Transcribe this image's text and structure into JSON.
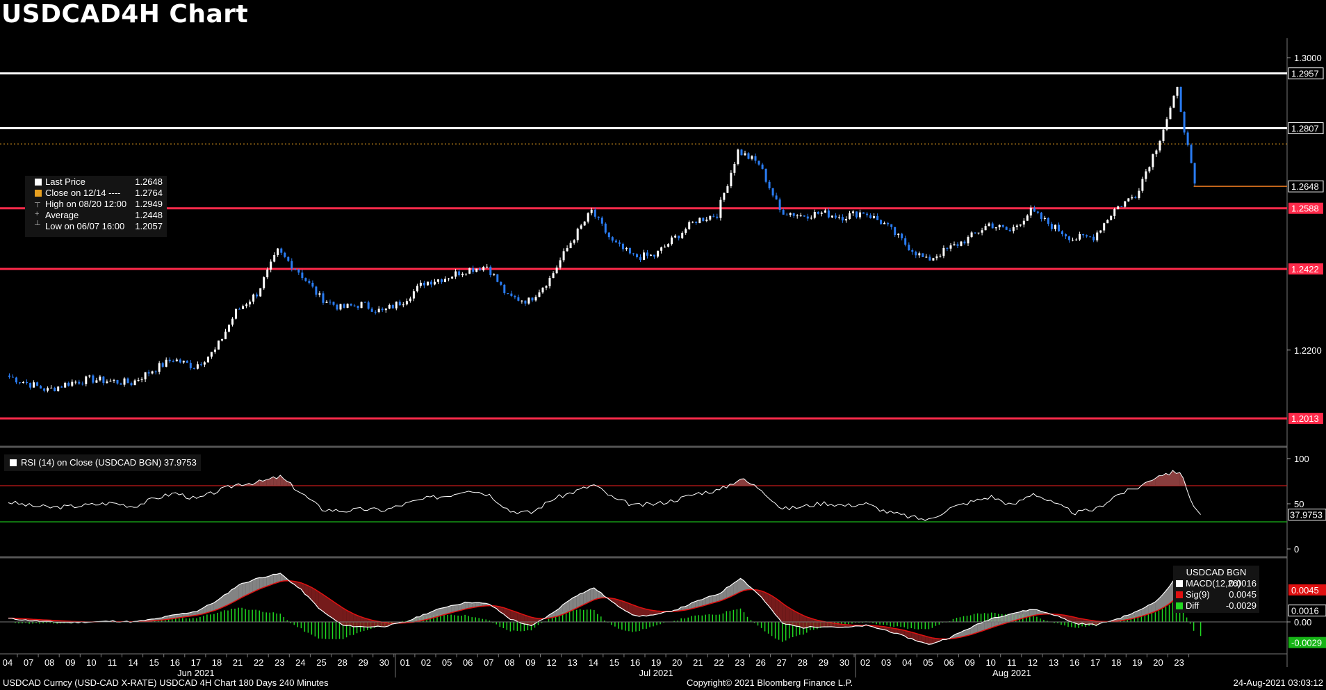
{
  "title": "USDCAD4H Chart",
  "footer": {
    "left": "USDCAD Curncy (USD-CAD X-RATE) USDCAD 4H Chart 180 Days 240 Minutes",
    "center": "Copyright© 2021 Bloomberg Finance L.P.",
    "right": "24-Aug-2021 03:03:12"
  },
  "legend": {
    "last_label": "Last Price",
    "last_value": "1.2648",
    "close_label": "Close on 12/14 ----",
    "close_value": "1.2764",
    "high_label": "High on 08/20 12:00",
    "high_value": "1.2949",
    "avg_label": "Average",
    "avg_value": "1.2448",
    "low_label": "Low on 06/07 16:00",
    "low_value": "1.2057"
  },
  "rsi_legend": "RSI (14)  on Close (USDCAD BGN) 37.9753",
  "macd_legend": {
    "title": "USDCAD BGN",
    "macd_label": "MACD(12,26)",
    "macd_value": "0.0016",
    "sig_label": "Sig(9)",
    "sig_value": "0.0045",
    "diff_label": "Diff",
    "diff_value": "-0.0029"
  },
  "colors": {
    "background": "#000000",
    "up_candle": "#ffffff",
    "down_candle": "#2a7cf2",
    "support_line": "#ff2a4a",
    "resistance_line": "#ffffff",
    "close_line": "#e8a020",
    "last_price_line": "#e87a20",
    "rsi_line": "#ffffff",
    "rsi_overbought": "#c41a1a",
    "rsi_oversold": "#1ab81a",
    "macd_line": "#ffffff",
    "signal_line": "#e01010",
    "diff_hist": "#21d821"
  },
  "chart_data": [
    {
      "type": "candlestick",
      "title": "USDCAD4H Chart",
      "price_axis": {
        "ticks": [
          "1.3000",
          "1.2200"
        ],
        "range": [
          1.196,
          1.304
        ]
      },
      "horizontal_levels": [
        {
          "label": "1.2957",
          "value": 1.2957,
          "color": "#ffffff"
        },
        {
          "label": "1.2807",
          "value": 1.2807,
          "color": "#ffffff"
        },
        {
          "label": "1.2588",
          "value": 1.2588,
          "color": "#ff2a4a"
        },
        {
          "label": "1.2422",
          "value": 1.2422,
          "color": "#ff2a4a"
        },
        {
          "label": "1.2013",
          "value": 1.2013,
          "color": "#ff2a4a"
        }
      ],
      "close_reference": 1.2764,
      "last_price": {
        "label": "1.2648",
        "value": 1.2648
      },
      "x_dates": [
        "04",
        "07",
        "08",
        "09",
        "10",
        "11",
        "14",
        "15",
        "16",
        "17",
        "18",
        "21",
        "22",
        "23",
        "24",
        "25",
        "28",
        "29",
        "30",
        "01",
        "02",
        "05",
        "06",
        "07",
        "08",
        "09",
        "12",
        "13",
        "14",
        "15",
        "16",
        "19",
        "20",
        "21",
        "22",
        "23",
        "26",
        "27",
        "28",
        "29",
        "30",
        "02",
        "03",
        "04",
        "05",
        "06",
        "09",
        "10",
        "11",
        "12",
        "13",
        "16",
        "17",
        "18",
        "19",
        "20",
        "23"
      ],
      "month_labels": [
        {
          "label": "Jun 2021",
          "at_index": 9
        },
        {
          "label": "Jul 2021",
          "at_index": 31
        },
        {
          "label": "Aug 2021",
          "at_index": 48
        }
      ],
      "daily_close": [
        1.213,
        1.211,
        1.209,
        1.211,
        1.212,
        1.2115,
        1.211,
        1.2145,
        1.2175,
        1.2155,
        1.2198,
        1.2305,
        1.2355,
        1.247,
        1.2415,
        1.2345,
        1.2315,
        1.2325,
        1.2305,
        1.2335,
        1.2385,
        1.2398,
        1.242,
        1.243,
        1.2345,
        1.2335,
        1.2395,
        1.2495,
        1.258,
        1.2495,
        1.2455,
        1.2458,
        1.2508,
        1.2555,
        1.2572,
        1.2745,
        1.271,
        1.2582,
        1.2568,
        1.2575,
        1.2565,
        1.2578,
        1.2545,
        1.249,
        1.2445,
        1.2475,
        1.2505,
        1.2545,
        1.2525,
        1.258,
        1.254,
        1.2505,
        1.251,
        1.2585,
        1.2625,
        1.2755,
        1.2912,
        1.2648
      ]
    },
    {
      "type": "line",
      "title": "RSI (14)  on Close (USDCAD BGN) 37.9753",
      "y_ticks": [
        "100",
        "50",
        "0"
      ],
      "ylim": [
        0,
        100
      ],
      "overbought": 70,
      "oversold": 30,
      "last_label": "37.9753",
      "daily_rsi": [
        52,
        48,
        46,
        47,
        49,
        51,
        47,
        56,
        62,
        55,
        64,
        72,
        74,
        80,
        62,
        44,
        42,
        44,
        43,
        50,
        56,
        59,
        66,
        60,
        42,
        40,
        55,
        63,
        71,
        55,
        48,
        50,
        55,
        62,
        65,
        78,
        66,
        44,
        47,
        51,
        48,
        50,
        41,
        36,
        32,
        45,
        52,
        58,
        48,
        62,
        50,
        40,
        44,
        60,
        68,
        82,
        86,
        38
      ]
    },
    {
      "type": "line",
      "title": "USDCAD BGN",
      "y_ticks": [
        "0.00"
      ],
      "ylim": [
        -0.0042,
        0.0085
      ],
      "series_labels": [
        "MACD(12,26)",
        "Sig(9)",
        "Diff"
      ],
      "value_labels": [
        "0.0045",
        "0.0016",
        "-0.0029"
      ],
      "daily_macd": [
        0.0005,
        0.0002,
        0.0,
        -0.0001,
        0.0,
        0.0001,
        0.0,
        0.0004,
        0.001,
        0.0015,
        0.003,
        0.0052,
        0.0062,
        0.0068,
        0.0045,
        0.0015,
        -0.0005,
        -0.0007,
        -0.0006,
        0.0,
        0.0012,
        0.0022,
        0.0028,
        0.0025,
        0.0004,
        -0.0006,
        0.0012,
        0.0035,
        0.0048,
        0.0025,
        0.0008,
        0.001,
        0.0018,
        0.003,
        0.004,
        0.0062,
        0.0035,
        -0.0002,
        -0.0008,
        -0.0006,
        -0.0008,
        -0.0005,
        -0.0012,
        -0.0022,
        -0.0032,
        -0.0022,
        -0.0008,
        0.0005,
        0.0012,
        0.0018,
        0.001,
        -0.0002,
        -0.0004,
        0.0004,
        0.0015,
        0.0032,
        0.0068,
        0.0016
      ]
    }
  ]
}
